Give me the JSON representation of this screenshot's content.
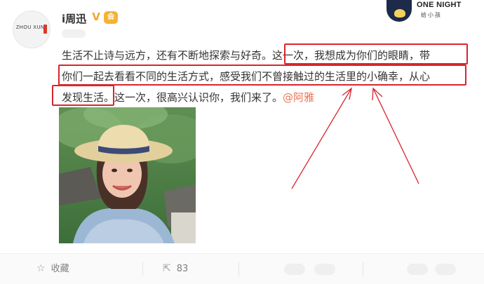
{
  "user": {
    "name": "i周迅",
    "avatar_text": "ZHOU XUN",
    "verified_icon": "verified-badge-icon",
    "member_icon": "member-badge-icon"
  },
  "post": {
    "lines": [
      {
        "plain": "生活不止诗与远方，还有不断地探索与好奇。",
        "rest": "这一次，我想成为你们的眼睛，带"
      },
      {
        "plain": "你们一起去看看不同的生活方式，感受我们不曾接触过的生活里的小确幸，从心"
      },
      {
        "plain": "发现生活。",
        "rest": "这一次，很高兴认识你，我们来了。",
        "mention": "@阿雅"
      }
    ],
    "highlight_color": "#d8252e",
    "mention_color": "#eb7350"
  },
  "watermark": {
    "title": "ONE NIGHT",
    "subtitle": "给小孩"
  },
  "actions": {
    "favorite_label": "收藏",
    "favorite_icon": "star-icon",
    "repost_count": "83",
    "repost_icon": "repost-icon"
  },
  "annotation": {
    "arrow_color": "#d8252e"
  }
}
